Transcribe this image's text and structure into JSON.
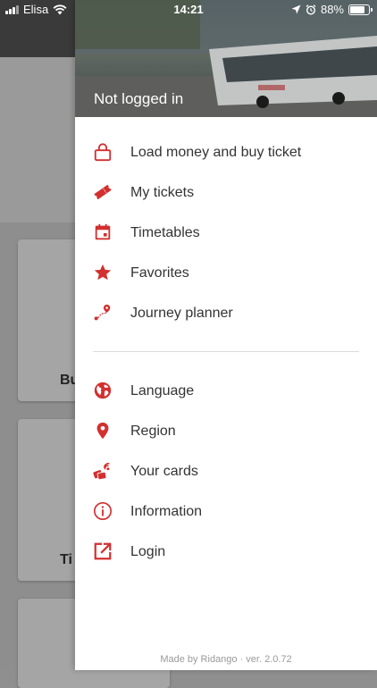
{
  "status_bar": {
    "carrier": "Elisa",
    "time": "14:21",
    "battery": "88%",
    "battery_level": 0.88
  },
  "background": {
    "card_labels": [
      "Bu",
      "Ti"
    ]
  },
  "drawer": {
    "login_status": "Not logged in",
    "primary_items": [
      {
        "label": "Load money and buy ticket",
        "icon": "lock-icon"
      },
      {
        "label": "My tickets",
        "icon": "ticket-icon"
      },
      {
        "label": "Timetables",
        "icon": "calendar-icon"
      },
      {
        "label": "Favorites",
        "icon": "star-icon"
      },
      {
        "label": "Journey planner",
        "icon": "route-icon"
      }
    ],
    "secondary_items": [
      {
        "label": "Language",
        "icon": "globe-icon"
      },
      {
        "label": "Region",
        "icon": "location-pin-icon"
      },
      {
        "label": "Your cards",
        "icon": "cards-icon"
      },
      {
        "label": "Information",
        "icon": "info-icon"
      },
      {
        "label": "Login",
        "icon": "login-icon"
      }
    ],
    "footer": "Made by Ridango · ver. 2.0.72"
  },
  "colors": {
    "accent": "#d32f2f",
    "text": "#333333"
  }
}
